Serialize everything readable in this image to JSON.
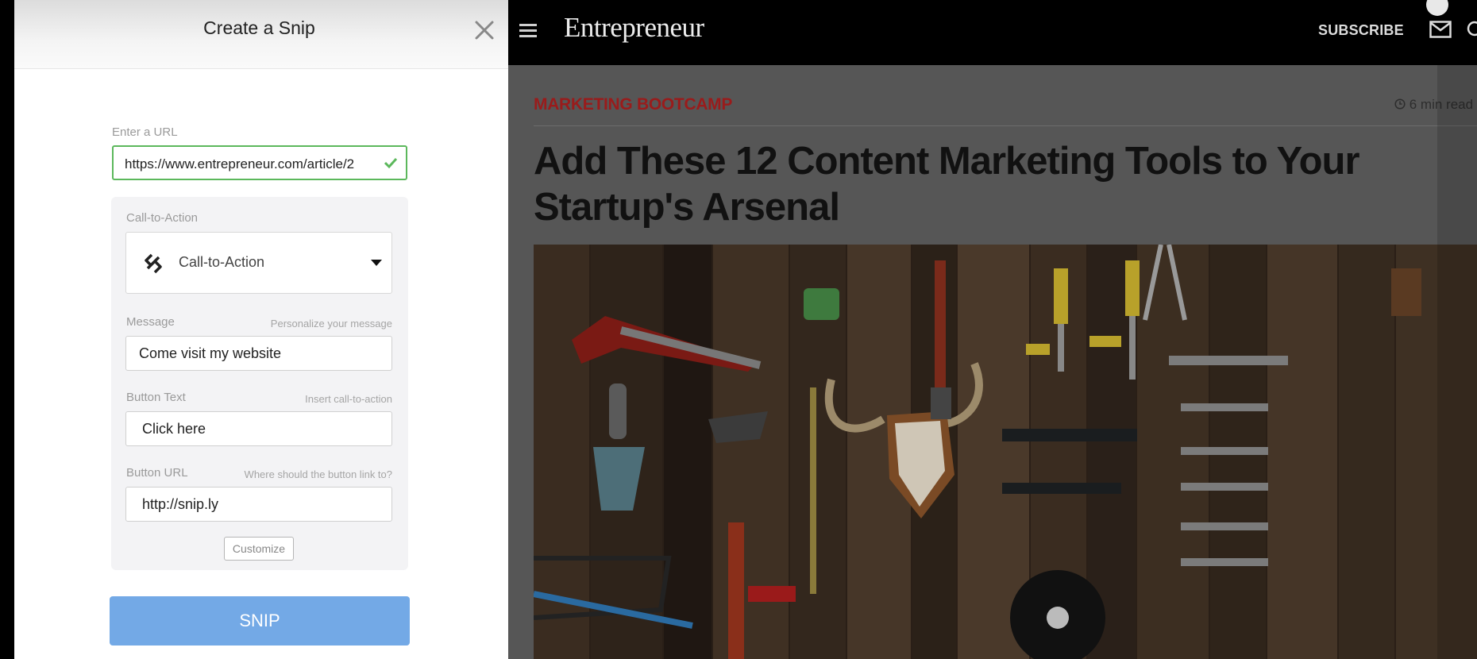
{
  "snip_panel": {
    "title": "Create a Snip",
    "url_label": "Enter a URL",
    "url_value": "https://www.entrepreneur.com/article/2",
    "cta_label": "Call-to-Action",
    "cta_select_value": "Call-to-Action",
    "message_label": "Message",
    "message_hint": "Personalize your message",
    "message_value": "Come visit my website",
    "button_text_label": "Button Text",
    "button_text_hint": "Insert call-to-action",
    "button_text_value": "Click here",
    "button_url_label": "Button URL",
    "button_url_hint": "Where should the button link to?",
    "button_url_value": "http://snip.ly",
    "customize_label": "Customize",
    "snip_label": "SNIP"
  },
  "site": {
    "logo": "Entrepreneur",
    "subscribe": "SUBSCRIBE",
    "category": "MARKETING BOOTCAMP",
    "read_time": "6 min read",
    "headline": "Add These 12 Content Marketing Tools to Your Startup's Arsenal"
  },
  "colors": {
    "snip_button": "#73a9e6",
    "url_valid_border": "#5cb85c",
    "category_red": "#9a1b1b"
  },
  "icons": [
    "close-icon",
    "check-icon",
    "snip-logo-icon",
    "caret-down-icon",
    "hamburger-icon",
    "mail-icon",
    "search-icon",
    "clock-icon"
  ]
}
